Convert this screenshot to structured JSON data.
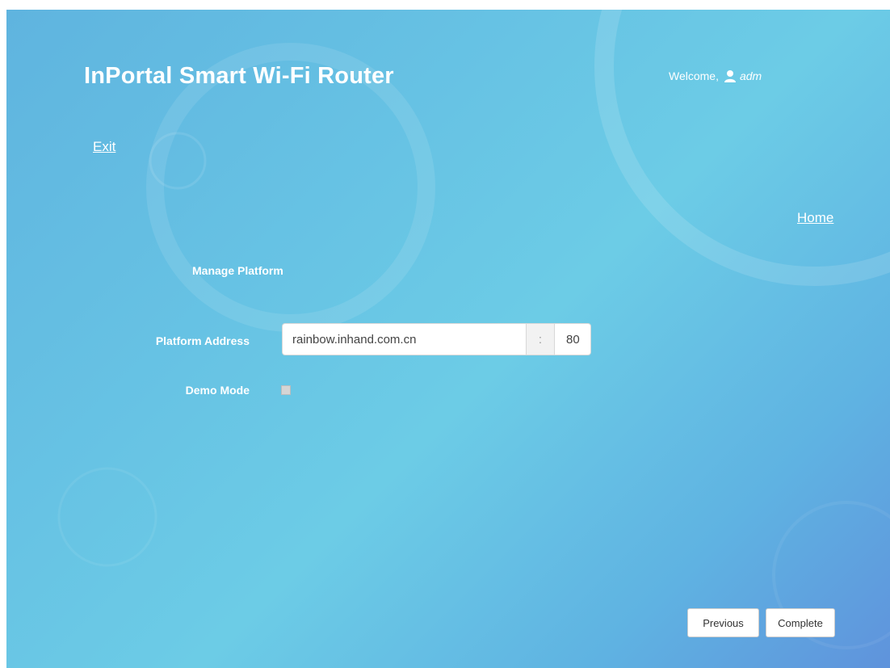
{
  "header": {
    "title": "InPortal Smart Wi-Fi Router",
    "welcome_label": "Welcome,",
    "username": "adm",
    "user_icon": "user-icon"
  },
  "nav": {
    "exit_label": "Exit",
    "home_label": "Home"
  },
  "form": {
    "section_title": "Manage Platform",
    "platform_address_label": "Platform Address",
    "platform_address_value": "rainbow.inhand.com.cn",
    "separator": ":",
    "port_value": "80",
    "demo_mode_label": "Demo Mode",
    "demo_mode_checked": false
  },
  "footer": {
    "previous_label": "Previous",
    "complete_label": "Complete"
  },
  "colors": {
    "background_accent": "#67c3e4",
    "text": "#ffffff"
  }
}
